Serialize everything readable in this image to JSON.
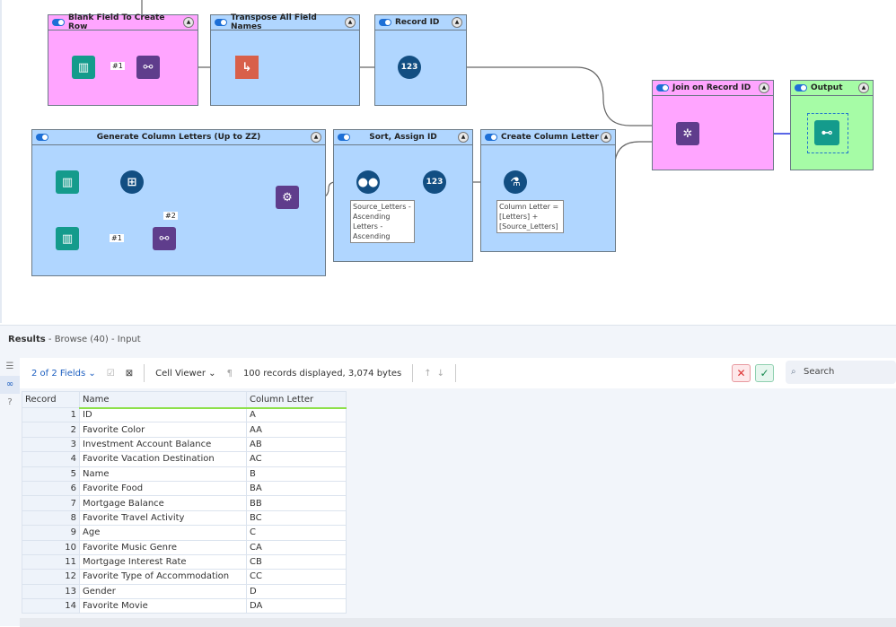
{
  "containers": {
    "blank": {
      "title": "Blank Field To Create Row",
      "tag": "#1"
    },
    "transpose": {
      "title": "Transpose All Field Names"
    },
    "recordid": {
      "title": "Record ID"
    },
    "generate": {
      "title": "Generate Column Letters (Up to ZZ)",
      "tag1": "#1",
      "tag2": "#2"
    },
    "sort": {
      "title": "Sort, Assign ID",
      "annotation": "Source_Letters - Ascending Letters - Ascending"
    },
    "create": {
      "title": "Create Column Letter",
      "annotation": "Column Letter = [Letters] + [Source_Letters]"
    },
    "join": {
      "title": "Join on Record ID"
    },
    "output": {
      "title": "Output"
    }
  },
  "results": {
    "title": "Results",
    "subtitle": "- Browse (40) - Input"
  },
  "toolbar": {
    "fields": "2 of 2 Fields",
    "viewer": "Cell Viewer",
    "info": "100 records displayed, 3,074 bytes",
    "search_placeholder": "Search"
  },
  "table": {
    "headers": [
      "Record",
      "Name",
      "Column Letter"
    ],
    "rows": [
      [
        "1",
        "ID",
        "A"
      ],
      [
        "2",
        "Favorite Color",
        "AA"
      ],
      [
        "3",
        "Investment Account Balance",
        "AB"
      ],
      [
        "4",
        "Favorite Vacation Destination",
        "AC"
      ],
      [
        "5",
        "Name",
        "B"
      ],
      [
        "6",
        "Favorite Food",
        "BA"
      ],
      [
        "7",
        "Mortgage Balance",
        "BB"
      ],
      [
        "8",
        "Favorite Travel Activity",
        "BC"
      ],
      [
        "9",
        "Age",
        "C"
      ],
      [
        "10",
        "Favorite Music Genre",
        "CA"
      ],
      [
        "11",
        "Mortgage Interest Rate",
        "CB"
      ],
      [
        "12",
        "Favorite Type of Accommodation",
        "CC"
      ],
      [
        "13",
        "Gender",
        "D"
      ],
      [
        "14",
        "Favorite Movie",
        "DA"
      ]
    ]
  }
}
